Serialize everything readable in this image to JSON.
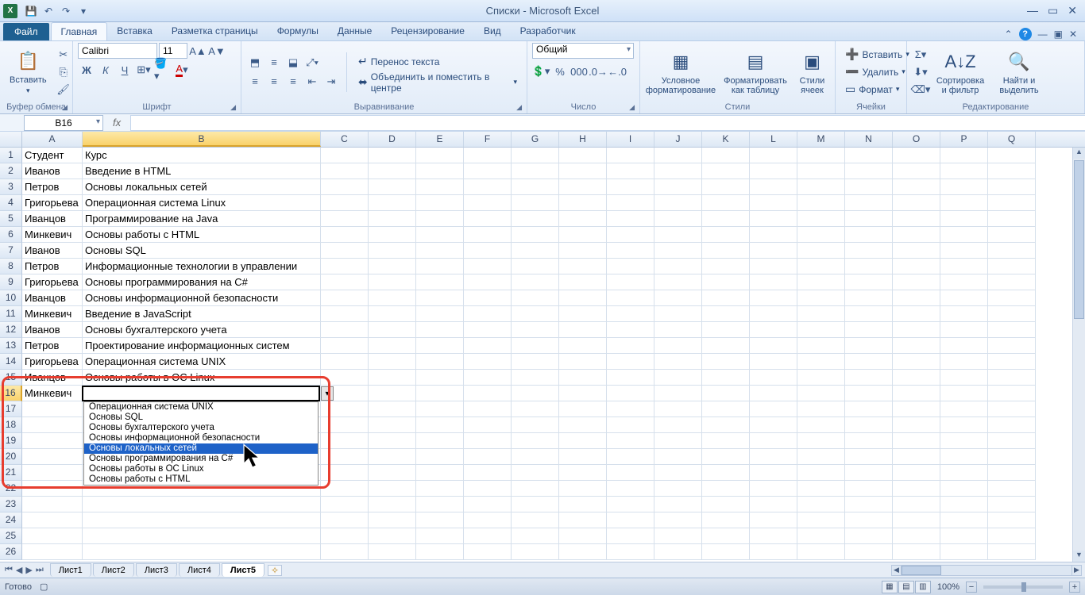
{
  "title": "Списки  -  Microsoft Excel",
  "qat": {
    "save": "💾",
    "undo": "↶",
    "redo": "↷"
  },
  "tabs": {
    "file": "Файл",
    "items": [
      "Главная",
      "Вставка",
      "Разметка страницы",
      "Формулы",
      "Данные",
      "Рецензирование",
      "Вид",
      "Разработчик"
    ],
    "activeIndex": 0
  },
  "ribbon": {
    "clipboard": {
      "paste": "Вставить",
      "label": "Буфер обмена"
    },
    "font": {
      "name": "Calibri",
      "size": "11",
      "label": "Шрифт",
      "bold": "Ж",
      "italic": "К",
      "underline": "Ч"
    },
    "alignment": {
      "wrap": "Перенос текста",
      "merge": "Объединить и поместить в центре",
      "label": "Выравнивание"
    },
    "number": {
      "format": "Общий",
      "label": "Число"
    },
    "styles": {
      "cond": "Условное форматирование",
      "table": "Форматировать как таблицу",
      "cell": "Стили ячеек",
      "label": "Стили"
    },
    "cells": {
      "insert": "Вставить",
      "delete": "Удалить",
      "format": "Формат",
      "label": "Ячейки"
    },
    "editing": {
      "sort": "Сортировка и фильтр",
      "find": "Найти и выделить",
      "label": "Редактирование"
    }
  },
  "nameBox": "B16",
  "columns": [
    "A",
    "B",
    "C",
    "D",
    "E",
    "F",
    "G",
    "H",
    "I",
    "J",
    "K",
    "L",
    "M",
    "N",
    "O",
    "P",
    "Q"
  ],
  "columnWidths": {
    "A": 76,
    "B": 300
  },
  "selectedColumn": "B",
  "selectedRow": 16,
  "rows": [
    {
      "n": 1,
      "A": "Студент",
      "B": "Курс"
    },
    {
      "n": 2,
      "A": "Иванов",
      "B": "Введение в HTML"
    },
    {
      "n": 3,
      "A": "Петров",
      "B": "Основы локальных сетей"
    },
    {
      "n": 4,
      "A": "Григорьева",
      "B": "Операционная система Linux"
    },
    {
      "n": 5,
      "A": "Иванцов",
      "B": "Программирование на Java"
    },
    {
      "n": 6,
      "A": "Минкевич",
      "B": "Основы работы с HTML"
    },
    {
      "n": 7,
      "A": "Иванов",
      "B": "Основы SQL"
    },
    {
      "n": 8,
      "A": "Петров",
      "B": "Информационные технологии в управлении"
    },
    {
      "n": 9,
      "A": "Григорьева",
      "B": "Основы программирования на C#"
    },
    {
      "n": 10,
      "A": "Иванцов",
      "B": "Основы информационной безопасности"
    },
    {
      "n": 11,
      "A": "Минкевич",
      "B": "Введение в JavaScript"
    },
    {
      "n": 12,
      "A": "Иванов",
      "B": "Основы бухгалтерского учета"
    },
    {
      "n": 13,
      "A": "Петров",
      "B": "Проектирование информационных систем"
    },
    {
      "n": 14,
      "A": "Григорьева",
      "B": "Операционная система UNIX"
    },
    {
      "n": 15,
      "A": "Иванцов",
      "B": "Основы работы в ОС Linux"
    },
    {
      "n": 16,
      "A": "Минкевич",
      "B": ""
    },
    {
      "n": 17
    },
    {
      "n": 18
    },
    {
      "n": 19
    },
    {
      "n": 20
    },
    {
      "n": 21
    },
    {
      "n": 22
    },
    {
      "n": 23
    },
    {
      "n": 24
    },
    {
      "n": 25
    },
    {
      "n": 26
    }
  ],
  "validationList": {
    "items": [
      "Операционная система UNIX",
      "Основы SQL",
      "Основы бухгалтерского учета",
      "Основы информационной безопасности",
      "Основы локальных сетей",
      "Основы программирования на C#",
      "Основы работы в ОС Linux",
      "Основы работы с HTML"
    ],
    "highlightedIndex": 4
  },
  "sheets": {
    "items": [
      "Лист1",
      "Лист2",
      "Лист3",
      "Лист4",
      "Лист5"
    ],
    "activeIndex": 4
  },
  "status": {
    "ready": "Готово",
    "zoom": "100%"
  }
}
